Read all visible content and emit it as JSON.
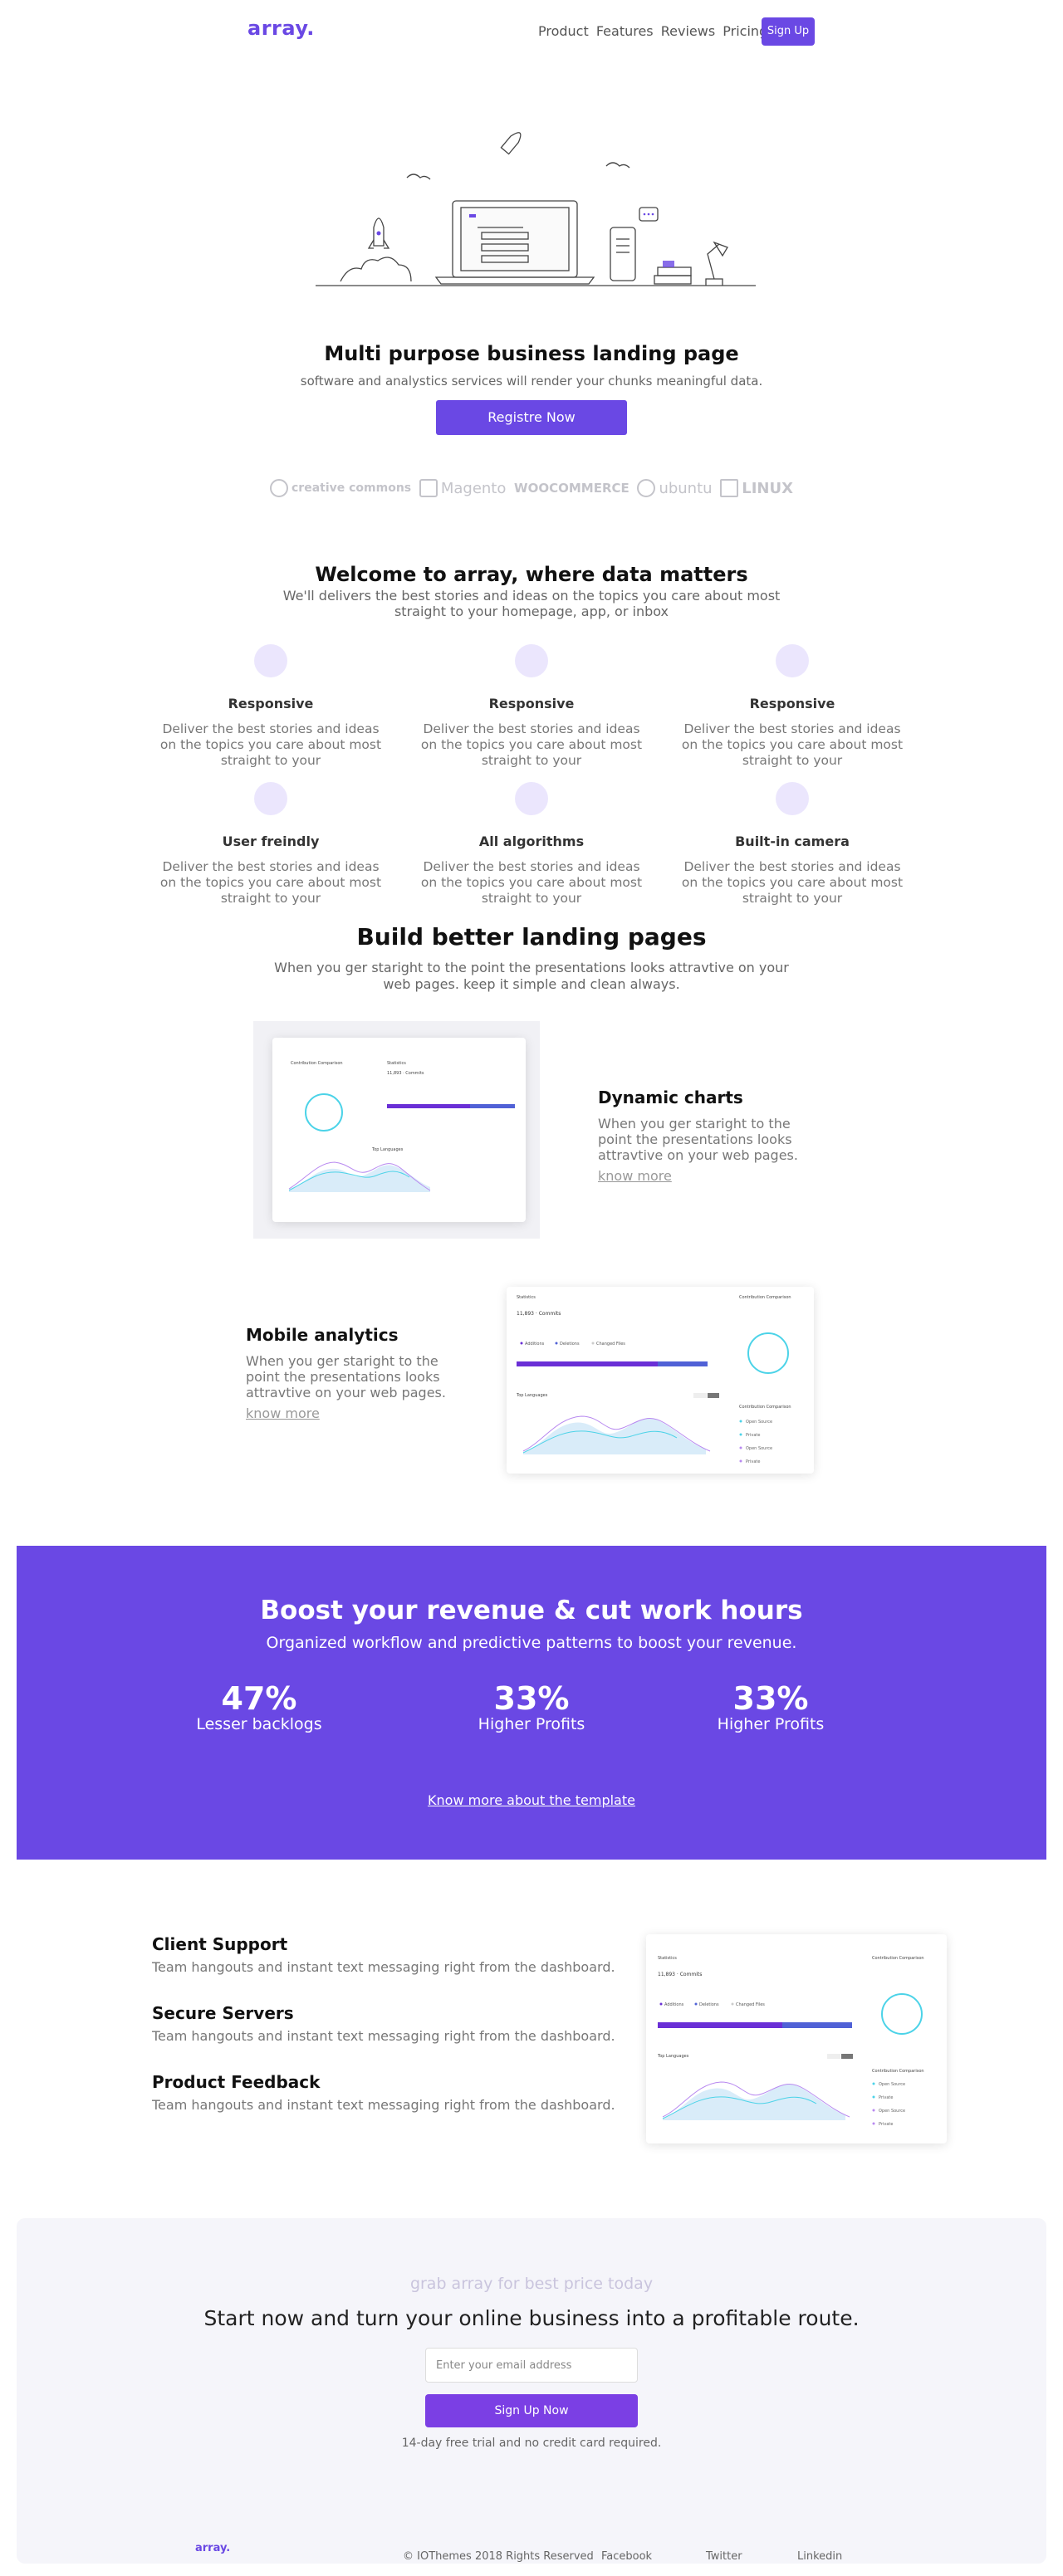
{
  "nav": {
    "logo": "array.",
    "links": [
      "Product",
      "Features",
      "Reviews",
      "Pricing"
    ],
    "signup_label": "Sign Up"
  },
  "hero": {
    "title": "Multi purpose business landing page",
    "subtitle": "software and analystics services will render your chunks meaningful data.",
    "cta_label": "Registre Now",
    "brands": [
      "creative commons",
      "Magento",
      "WOOCOMMERCE",
      "ubuntu",
      "LINUX"
    ]
  },
  "welcome": {
    "title": "Welcome to array, where data matters",
    "subtitle": "We'll delivers the best stories and ideas on the topics you care about most straight to your homepage, app, or inbox",
    "features": [
      {
        "title": "Responsive",
        "desc": "Deliver the best stories and ideas on the topics you care about most straight to your"
      },
      {
        "title": "Responsive",
        "desc": "Deliver the best stories and ideas on the topics you care about most straight to your"
      },
      {
        "title": "Responsive",
        "desc": "Deliver the best stories and ideas on the topics you care about most straight to your"
      },
      {
        "title": "User freindly",
        "desc": "Deliver the best stories and ideas on the topics you care about most straight to your"
      },
      {
        "title": "All algorithms",
        "desc": "Deliver the best stories and ideas on the topics you care about most straight to your"
      },
      {
        "title": "Built-in camera",
        "desc": "Deliver the best stories and ideas on the topics you care about most straight to your"
      }
    ]
  },
  "build": {
    "title": "Build better landing pages",
    "subtitle": "When you ger staright to the point the presentations looks attravtive on your web pages. keep it simple and clean always.",
    "blocks": [
      {
        "title": "Dynamic charts",
        "desc": "When you ger staright to the point the presentations looks attravtive on your web pages.",
        "link": "know more"
      },
      {
        "title": "Mobile analytics",
        "desc": "When you ger staright to the point the presentations looks attravtive on your web pages.",
        "link": "know more"
      }
    ]
  },
  "dashboard": {
    "stats_title": "Statistics",
    "commits": "11,893 · Commits",
    "legend": [
      "Additions",
      "Deletions",
      "Changed Files"
    ],
    "side_title": "Contribution Comparison",
    "side_items": [
      "Open Source",
      "Private",
      "Open Source",
      "Private"
    ],
    "chart_title": "Top Languages"
  },
  "band": {
    "title": "Boost your revenue & cut work hours",
    "subtitle": "Organized workflow and predictive patterns to boost your revenue.",
    "stats": [
      {
        "value": "47%",
        "label": "Lesser backlogs"
      },
      {
        "value": "33%",
        "label": "Higher Profits"
      },
      {
        "value": "33%",
        "label": "Higher Profits"
      }
    ],
    "link": "Know more about the template"
  },
  "support": [
    {
      "title": "Client Support",
      "desc": "Team hangouts and instant text messaging right from the dashboard."
    },
    {
      "title": "Secure Servers",
      "desc": "Team hangouts and instant text messaging right from the dashboard."
    },
    {
      "title": "Product Feedback",
      "desc": "Team hangouts and instant text messaging right from the dashboard."
    }
  ],
  "cta": {
    "kicker": "grab array for best price today",
    "title": "Start now and turn your online business into a profitable route.",
    "email_placeholder": "Enter your email address",
    "button_label": "Sign Up Now",
    "note": "14-day free trial and no credit card required."
  },
  "footer": {
    "logo": "array.",
    "copyright": "© IOThemes 2018 Rights Reserved",
    "links": [
      "Facebook",
      "Twitter",
      "Linkedin"
    ]
  },
  "colors": {
    "accent": "#6a48e4",
    "cta_button": "#7b3fe4",
    "feature_circle": "#ebe6fd"
  }
}
